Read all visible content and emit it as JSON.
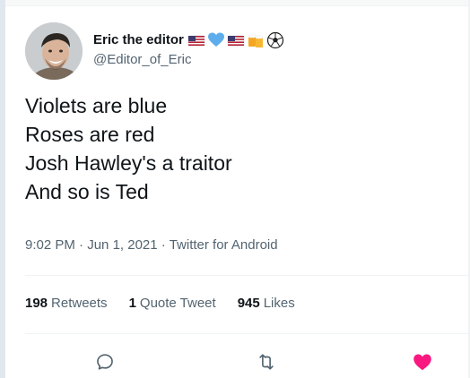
{
  "tweet": {
    "author": {
      "display_name": "Eric the editor",
      "handle": "@Editor_of_Eric",
      "name_emojis": [
        "us-flag-icon",
        "blue-heart-icon",
        "us-flag-icon",
        "beer-mugs-icon",
        "soccer-ball-icon"
      ]
    },
    "text_lines": [
      "Violets are blue",
      "Roses are red",
      "Josh Hawley's a traitor",
      "And so is Ted"
    ],
    "meta": {
      "time": "9:02 PM",
      "date": "Jun 1, 2021",
      "source": "Twitter for Android",
      "separator": "·"
    },
    "stats": {
      "retweets_count": "198",
      "retweets_label": "Retweets",
      "quotes_count": "1",
      "quotes_label": "Quote Tweet",
      "likes_count": "945",
      "likes_label": "Likes"
    },
    "colors": {
      "text_primary": "#0f1419",
      "text_secondary": "#536471",
      "icon_gray": "#536471",
      "like_red": "#f91880",
      "divider": "#eff3f4"
    }
  }
}
